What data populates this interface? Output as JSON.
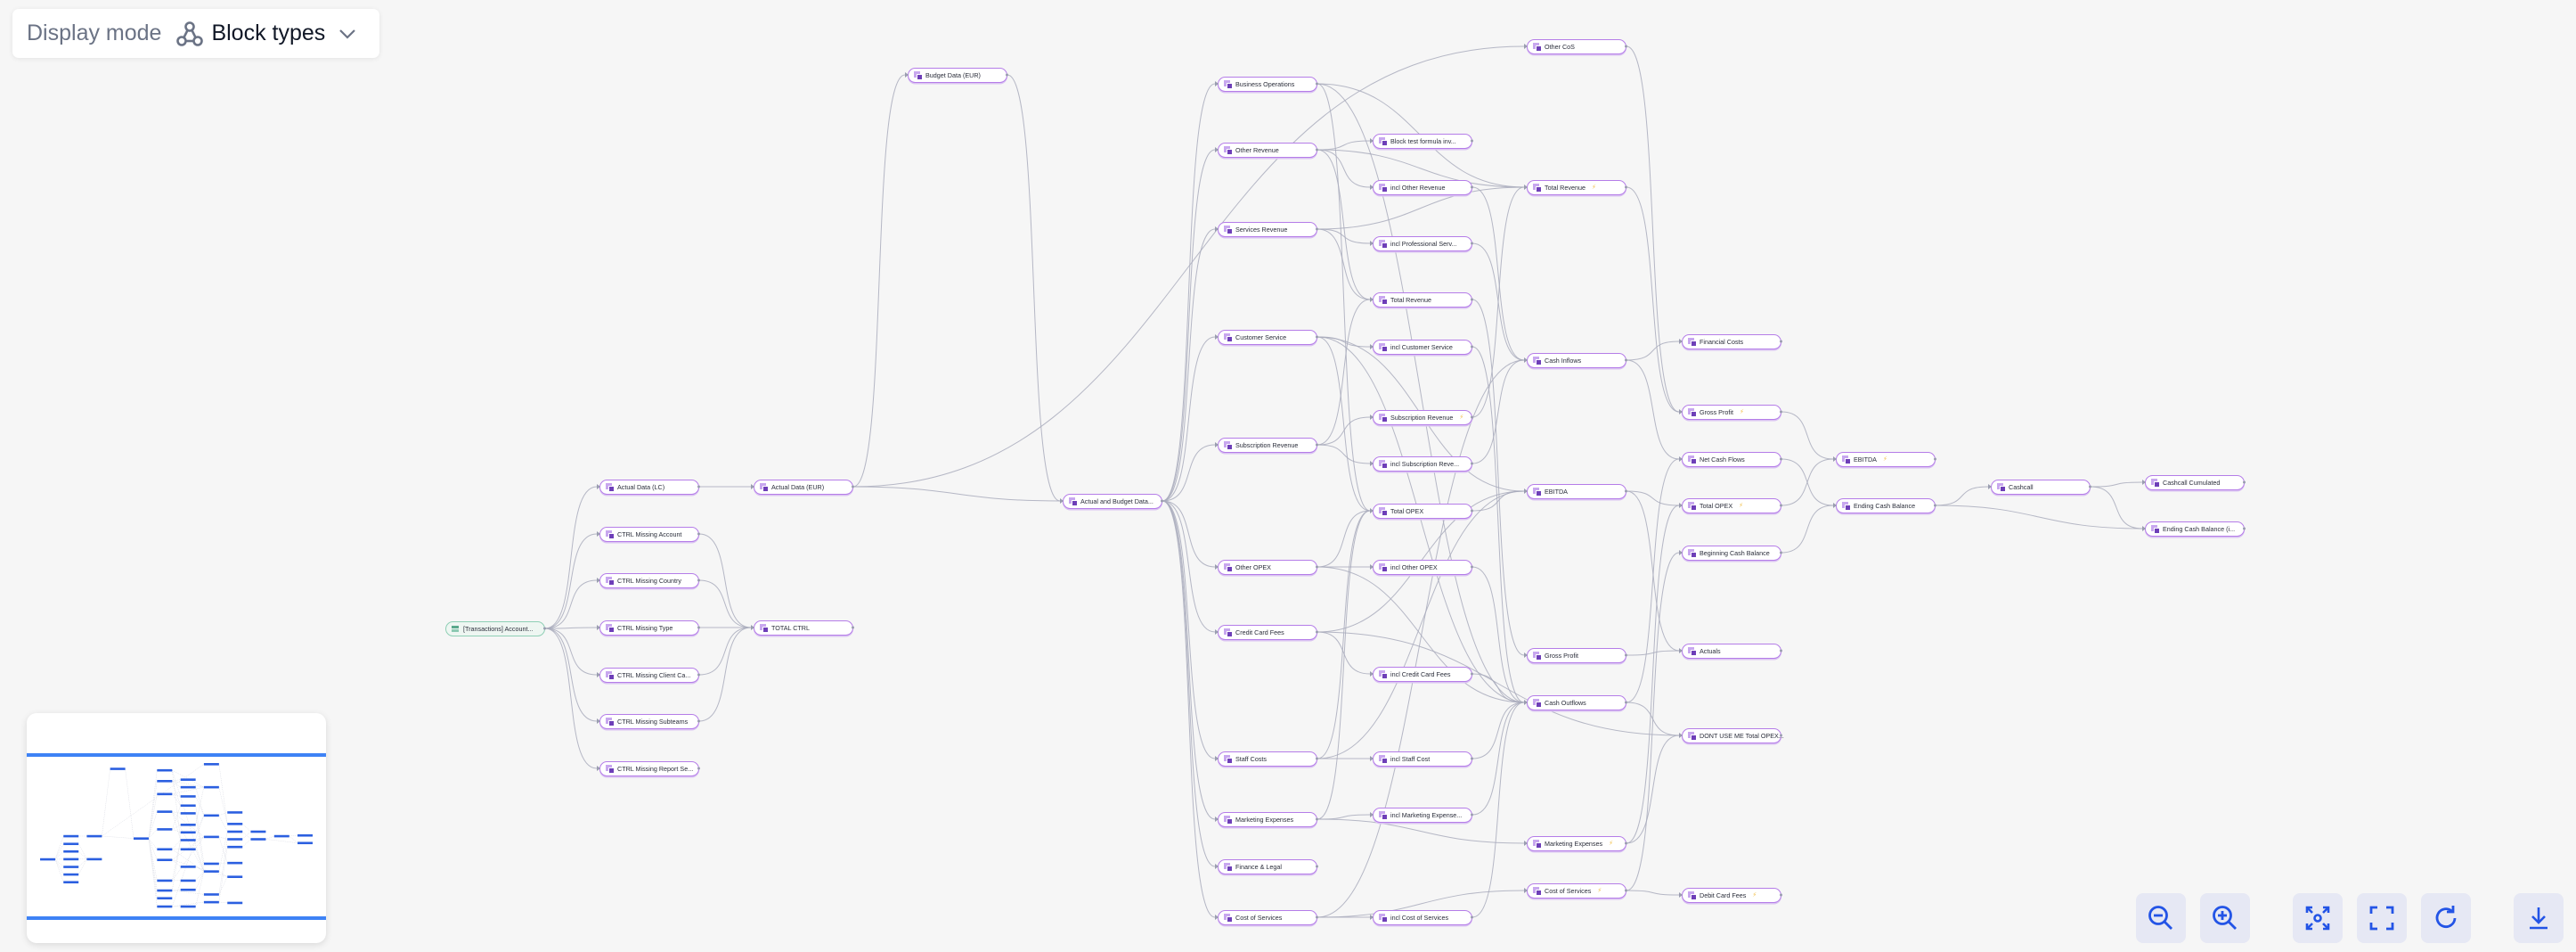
{
  "display_mode": {
    "label": "Display mode",
    "value": "Block types",
    "icon": "graph-nodes-icon",
    "dropdown_icon": "chevron-down-icon"
  },
  "colors": {
    "background": "#f6f6f6",
    "node_border": "#b57de8",
    "node_icon_dark": "#6e3fb8",
    "node_icon_light": "#c8a7ef",
    "source_node_border": "#8fcfb5",
    "edge": "#a9acbc",
    "bolt": "#f2c14e",
    "control_bg": "#e6e8f4",
    "control_icon": "#2354e6",
    "minimap_band": "#3e82f5",
    "minimap_node": "#2b5fe0"
  },
  "graph": {
    "nodes": [
      {
        "id": "transactions",
        "label": "[Transactions] Account...",
        "type": "table"
      },
      {
        "id": "actual_lc",
        "label": "Actual Data (LC)",
        "type": "block"
      },
      {
        "id": "ctrl_account",
        "label": "CTRL Missing Account",
        "type": "block"
      },
      {
        "id": "ctrl_country",
        "label": "CTRL Missing Country",
        "type": "block"
      },
      {
        "id": "ctrl_type",
        "label": "CTRL Missing Type",
        "type": "block"
      },
      {
        "id": "ctrl_client",
        "label": "CTRL Missing Client Ca...",
        "type": "block"
      },
      {
        "id": "ctrl_subteams",
        "label": "CTRL Missing Subteams",
        "type": "block"
      },
      {
        "id": "ctrl_report",
        "label": "CTRL Missing Report Se...",
        "type": "block"
      },
      {
        "id": "actual_eur",
        "label": "Actual Data (EUR)",
        "type": "block"
      },
      {
        "id": "total_ctrl",
        "label": "TOTAL CTRL",
        "type": "block"
      },
      {
        "id": "budget_eur",
        "label": "Budget Data (EUR)",
        "type": "block"
      },
      {
        "id": "actual_budget",
        "label": "Actual and Budget Data...",
        "type": "block"
      },
      {
        "id": "business_ops",
        "label": "Business Operations",
        "type": "block"
      },
      {
        "id": "other_revenue",
        "label": "Other Revenue",
        "type": "block"
      },
      {
        "id": "services_revenue",
        "label": "Services Revenue",
        "type": "block"
      },
      {
        "id": "customer_service",
        "label": "Customer Service",
        "type": "block"
      },
      {
        "id": "subscription_revenue",
        "label": "Subscription Revenue",
        "type": "block"
      },
      {
        "id": "other_opex",
        "label": "Other OPEX",
        "type": "block"
      },
      {
        "id": "credit_card_fees",
        "label": "Credit Card Fees",
        "type": "block"
      },
      {
        "id": "staff_costs",
        "label": "Staff Costs",
        "type": "block"
      },
      {
        "id": "marketing_expenses",
        "label": "Marketing Expenses",
        "type": "block"
      },
      {
        "id": "finance_legal",
        "label": "Finance & Legal",
        "type": "block"
      },
      {
        "id": "cost_of_services",
        "label": "Cost of Services",
        "type": "block"
      },
      {
        "id": "block_test",
        "label": "Block test formula inv...",
        "type": "block"
      },
      {
        "id": "incl_other_revenue",
        "label": "incl Other Revenue",
        "type": "block"
      },
      {
        "id": "incl_prof_serv",
        "label": "incl Professional Serv...",
        "type": "block"
      },
      {
        "id": "total_revenue_a",
        "label": "Total Revenue",
        "type": "block"
      },
      {
        "id": "incl_customer_service",
        "label": "incl Customer Service",
        "type": "block"
      },
      {
        "id": "subscription_revenue_b",
        "label": "Subscription Revenue",
        "type": "block",
        "bolt": true
      },
      {
        "id": "incl_subscription",
        "label": "incl Subscription Reve...",
        "type": "block"
      },
      {
        "id": "total_opex_a",
        "label": "Total OPEX",
        "type": "block"
      },
      {
        "id": "incl_other_opex",
        "label": "incl Other OPEX",
        "type": "block"
      },
      {
        "id": "incl_credit_card",
        "label": "incl Credit Card Fees",
        "type": "block"
      },
      {
        "id": "incl_staff_cost",
        "label": "incl Staff Cost",
        "type": "block"
      },
      {
        "id": "incl_marketing",
        "label": "incl Marketing Expense...",
        "type": "block"
      },
      {
        "id": "incl_cost_services",
        "label": "incl Cost of Services",
        "type": "block"
      },
      {
        "id": "other_cos",
        "label": "Other CoS",
        "type": "block"
      },
      {
        "id": "total_revenue_b",
        "label": "Total Revenue",
        "type": "block",
        "bolt": true
      },
      {
        "id": "cash_inflows",
        "label": "Cash Inflows",
        "type": "block"
      },
      {
        "id": "ebitda_a",
        "label": "EBITDA",
        "type": "block"
      },
      {
        "id": "gross_profit_a",
        "label": "Gross Profit",
        "type": "block"
      },
      {
        "id": "cash_outflows",
        "label": "Cash Outflows",
        "type": "block"
      },
      {
        "id": "marketing_expenses_b",
        "label": "Marketing Expenses",
        "type": "block",
        "bolt": true
      },
      {
        "id": "cost_of_services_b",
        "label": "Cost of Services",
        "type": "block",
        "bolt": true
      },
      {
        "id": "financial_costs",
        "label": "Financial Costs",
        "type": "block"
      },
      {
        "id": "gross_profit_b",
        "label": "Gross Profit",
        "type": "block",
        "bolt": true
      },
      {
        "id": "net_cash_flows",
        "label": "Net Cash Flows",
        "type": "block"
      },
      {
        "id": "total_opex_b",
        "label": "Total OPEX",
        "type": "block",
        "bolt": true
      },
      {
        "id": "beginning_cash",
        "label": "Beginning Cash Balance",
        "type": "block"
      },
      {
        "id": "actuals",
        "label": "Actuals",
        "type": "block"
      },
      {
        "id": "dont_use_me",
        "label": "DONT USE ME Total OPEX...",
        "type": "block"
      },
      {
        "id": "debit_card_fees",
        "label": "Debit Card Fees",
        "type": "block",
        "bolt": true
      },
      {
        "id": "ebitda_b",
        "label": "EBITDA",
        "type": "block",
        "bolt": true
      },
      {
        "id": "ending_cash",
        "label": "Ending Cash Balance",
        "type": "block"
      },
      {
        "id": "cashcall",
        "label": "Cashcall",
        "type": "block"
      },
      {
        "id": "cashcall_cumulated",
        "label": "Cashcall Cumulated",
        "type": "block"
      },
      {
        "id": "ending_cash_i",
        "label": "Ending Cash Balance (i...",
        "type": "block"
      }
    ],
    "edges": [
      [
        "transactions",
        "actual_lc"
      ],
      [
        "transactions",
        "ctrl_account"
      ],
      [
        "transactions",
        "ctrl_country"
      ],
      [
        "transactions",
        "ctrl_type"
      ],
      [
        "transactions",
        "ctrl_client"
      ],
      [
        "transactions",
        "ctrl_subteams"
      ],
      [
        "transactions",
        "ctrl_report"
      ],
      [
        "actual_lc",
        "actual_eur"
      ],
      [
        "ctrl_account",
        "total_ctrl"
      ],
      [
        "ctrl_country",
        "total_ctrl"
      ],
      [
        "ctrl_type",
        "total_ctrl"
      ],
      [
        "ctrl_client",
        "total_ctrl"
      ],
      [
        "ctrl_subteams",
        "total_ctrl"
      ],
      [
        "actual_eur",
        "budget_eur"
      ],
      [
        "actual_eur",
        "actual_budget"
      ],
      [
        "actual_eur",
        "other_cos"
      ],
      [
        "budget_eur",
        "actual_budget"
      ],
      [
        "actual_budget",
        "business_ops"
      ],
      [
        "actual_budget",
        "other_revenue"
      ],
      [
        "actual_budget",
        "services_revenue"
      ],
      [
        "actual_budget",
        "customer_service"
      ],
      [
        "actual_budget",
        "subscription_revenue"
      ],
      [
        "actual_budget",
        "other_opex"
      ],
      [
        "actual_budget",
        "credit_card_fees"
      ],
      [
        "actual_budget",
        "staff_costs"
      ],
      [
        "actual_budget",
        "marketing_expenses"
      ],
      [
        "actual_budget",
        "finance_legal"
      ],
      [
        "actual_budget",
        "cost_of_services"
      ],
      [
        "business_ops",
        "total_opex_a"
      ],
      [
        "business_ops",
        "total_revenue_b"
      ],
      [
        "business_ops",
        "cash_outflows"
      ],
      [
        "other_revenue",
        "block_test"
      ],
      [
        "other_revenue",
        "incl_other_revenue"
      ],
      [
        "other_revenue",
        "total_revenue_a"
      ],
      [
        "other_revenue",
        "total_revenue_b"
      ],
      [
        "services_revenue",
        "incl_prof_serv"
      ],
      [
        "services_revenue",
        "total_revenue_a"
      ],
      [
        "services_revenue",
        "total_revenue_b"
      ],
      [
        "customer_service",
        "incl_customer_service"
      ],
      [
        "customer_service",
        "total_opex_a"
      ],
      [
        "customer_service",
        "ebitda_a"
      ],
      [
        "customer_service",
        "cash_outflows"
      ],
      [
        "subscription_revenue",
        "subscription_revenue_b"
      ],
      [
        "subscription_revenue",
        "incl_subscription"
      ],
      [
        "subscription_revenue",
        "total_revenue_a"
      ],
      [
        "other_opex",
        "incl_other_opex"
      ],
      [
        "other_opex",
        "total_opex_a"
      ],
      [
        "other_opex",
        "cash_outflows"
      ],
      [
        "credit_card_fees",
        "incl_credit_card"
      ],
      [
        "credit_card_fees",
        "ebitda_a"
      ],
      [
        "credit_card_fees",
        "dont_use_me"
      ],
      [
        "staff_costs",
        "incl_staff_cost"
      ],
      [
        "staff_costs",
        "total_opex_a"
      ],
      [
        "staff_costs",
        "ebitda_a"
      ],
      [
        "marketing_expenses",
        "incl_marketing"
      ],
      [
        "marketing_expenses",
        "total_opex_a"
      ],
      [
        "marketing_expenses",
        "marketing_expenses_b"
      ],
      [
        "cost_of_services",
        "incl_cost_services"
      ],
      [
        "cost_of_services",
        "cash_inflows"
      ],
      [
        "cost_of_services",
        "cost_of_services_b"
      ],
      [
        "incl_other_revenue",
        "cash_inflows"
      ],
      [
        "incl_prof_serv",
        "cash_inflows"
      ],
      [
        "total_revenue_a",
        "gross_profit_a"
      ],
      [
        "incl_customer_service",
        "cash_outflows"
      ],
      [
        "subscription_revenue_b",
        "total_revenue_b"
      ],
      [
        "incl_subscription",
        "cash_inflows"
      ],
      [
        "total_opex_a",
        "ebitda_a"
      ],
      [
        "incl_other_opex",
        "cash_outflows"
      ],
      [
        "incl_credit_card",
        "cash_outflows"
      ],
      [
        "incl_staff_cost",
        "cash_outflows"
      ],
      [
        "incl_marketing",
        "cash_outflows"
      ],
      [
        "incl_cost_services",
        "cash_outflows"
      ],
      [
        "other_cos",
        "gross_profit_b"
      ],
      [
        "total_revenue_b",
        "gross_profit_b"
      ],
      [
        "cash_inflows",
        "net_cash_flows"
      ],
      [
        "cash_inflows",
        "financial_costs"
      ],
      [
        "ebitda_a",
        "total_opex_b"
      ],
      [
        "ebitda_a",
        "actuals"
      ],
      [
        "gross_profit_a",
        "actuals"
      ],
      [
        "cash_outflows",
        "net_cash_flows"
      ],
      [
        "cash_outflows",
        "dont_use_me"
      ],
      [
        "marketing_expenses_b",
        "total_opex_b"
      ],
      [
        "marketing_expenses_b",
        "dont_use_me"
      ],
      [
        "cost_of_services_b",
        "debit_card_fees"
      ],
      [
        "cost_of_services_b",
        "beginning_cash"
      ],
      [
        "gross_profit_b",
        "ebitda_b"
      ],
      [
        "net_cash_flows",
        "ending_cash"
      ],
      [
        "total_opex_b",
        "ebitda_b"
      ],
      [
        "beginning_cash",
        "ending_cash"
      ],
      [
        "ending_cash",
        "cashcall"
      ],
      [
        "ending_cash",
        "ending_cash_i"
      ],
      [
        "cashcall",
        "cashcall_cumulated"
      ],
      [
        "cashcall",
        "ending_cash_i"
      ]
    ]
  },
  "controls": [
    {
      "id": "zoom_out",
      "label": "Zoom out",
      "icon": "zoom-out-icon"
    },
    {
      "id": "zoom_in",
      "label": "Zoom in",
      "icon": "zoom-in-icon"
    },
    {
      "id": "focus",
      "label": "Focus",
      "icon": "focus-icon"
    },
    {
      "id": "fit_view",
      "label": "Fit view",
      "icon": "fit-view-icon"
    },
    {
      "id": "reset",
      "label": "Reset",
      "icon": "refresh-icon"
    },
    {
      "id": "download",
      "label": "Download",
      "icon": "download-icon"
    }
  ],
  "minimap": {
    "label": "Minimap"
  }
}
